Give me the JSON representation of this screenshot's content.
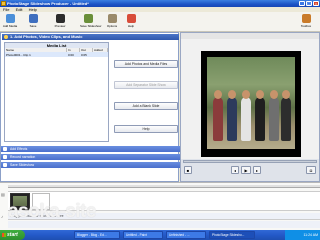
{
  "window": {
    "title": "PhotoStage Slideshow Producer - Untitled*"
  },
  "menu": [
    "File",
    "Edit",
    "Help"
  ],
  "toolbar": [
    {
      "label": "Add Media",
      "icon": "add-media-icon",
      "color": "#4b8fd8"
    },
    {
      "label": "Save",
      "icon": "save-icon",
      "color": "#3f6fbf"
    },
    {
      "label": "Preview",
      "icon": "preview-icon",
      "color": "#2c2c2c"
    },
    {
      "label": "Save Slideshow",
      "icon": "save-slideshow-icon",
      "color": "#6a8f3a"
    },
    {
      "label": "Options",
      "icon": "options-icon",
      "color": "#9a8a6a"
    },
    {
      "label": "Help",
      "icon": "help-icon",
      "color": "#d84d3a"
    },
    {
      "label": "Toolbox",
      "icon": "toolbox-icon",
      "color": "#c97b2a"
    }
  ],
  "media_panel": {
    "header": "1. Add Photos, Video Clips, and Music",
    "list_title": "Media List",
    "columns": [
      "Name",
      "In",
      "Out",
      "Added"
    ],
    "rows": [
      {
        "name": "Photo0001 - Clip 1",
        "in": "0:00",
        "out": "0:05",
        "added": ""
      }
    ]
  },
  "buttons": {
    "add_photos": "Add Photos and Media Files",
    "add_separator": "Add Separator Slide Show",
    "add_blank": "Add a Blank Slide",
    "help": "Help"
  },
  "sections": [
    "Add Effects",
    "Record narration",
    "Save Slideshow"
  ],
  "timeline": {
    "audio_hint": "Drag your music or sound files here"
  },
  "taskbar": {
    "start": "start",
    "tasks": [
      "Blogger - Blog - Ed...",
      "Untitled - Paint",
      "Unfinished - ...",
      "PhotoStage Slidesho..."
    ],
    "time": "11:24 AM"
  },
  "watermark": "asoka-site"
}
